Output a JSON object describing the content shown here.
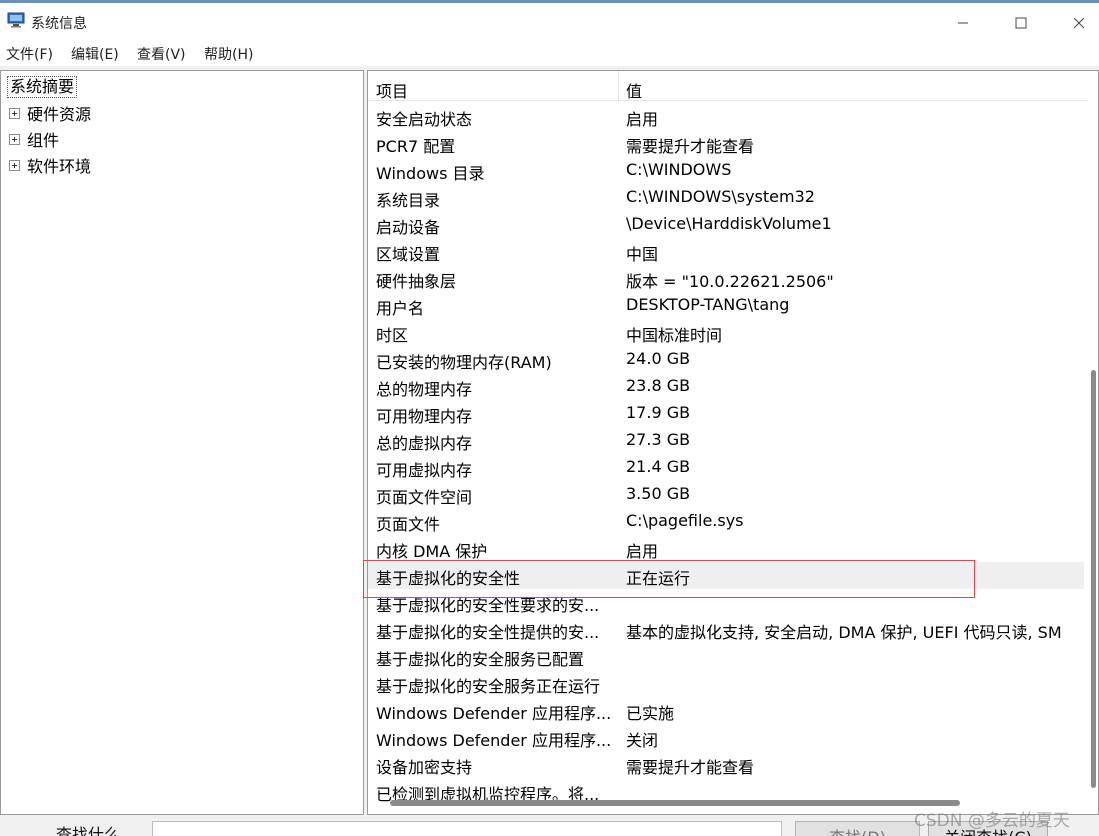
{
  "window": {
    "title": "系统信息"
  },
  "menu": {
    "file": "文件(F)",
    "edit": "编辑(E)",
    "view": "查看(V)",
    "help": "帮助(H)"
  },
  "tree": {
    "root": "系统摘要",
    "items": [
      {
        "label": "硬件资源"
      },
      {
        "label": "组件"
      },
      {
        "label": "软件环境"
      }
    ]
  },
  "list": {
    "columns": {
      "item": "项目",
      "value": "值"
    },
    "rows": [
      {
        "item": "安全启动状态",
        "value": "启用"
      },
      {
        "item": "PCR7 配置",
        "value": "需要提升才能查看"
      },
      {
        "item": "Windows 目录",
        "value": "C:\\WINDOWS"
      },
      {
        "item": "系统目录",
        "value": "C:\\WINDOWS\\system32"
      },
      {
        "item": "启动设备",
        "value": "\\Device\\HarddiskVolume1"
      },
      {
        "item": "区域设置",
        "value": "中国"
      },
      {
        "item": "硬件抽象层",
        "value": "版本 = \"10.0.22621.2506\""
      },
      {
        "item": "用户名",
        "value": "DESKTOP-TANG\\tang"
      },
      {
        "item": "时区",
        "value": "中国标准时间"
      },
      {
        "item": "已安装的物理内存(RAM)",
        "value": "24.0 GB"
      },
      {
        "item": "总的物理内存",
        "value": "23.8 GB"
      },
      {
        "item": "可用物理内存",
        "value": "17.9 GB"
      },
      {
        "item": "总的虚拟内存",
        "value": "27.3 GB"
      },
      {
        "item": "可用虚拟内存",
        "value": "21.4 GB"
      },
      {
        "item": "页面文件空间",
        "value": "3.50 GB"
      },
      {
        "item": "页面文件",
        "value": "C:\\pagefile.sys"
      },
      {
        "item": "内核 DMA 保护",
        "value": "启用"
      },
      {
        "item": "基于虚拟化的安全性",
        "value": "正在运行"
      },
      {
        "item": "基于虚拟化的安全性要求的安...",
        "value": ""
      },
      {
        "item": "基于虚拟化的安全性提供的安...",
        "value": "基本的虚拟化支持, 安全启动, DMA 保护, UEFI 代码只读, SM"
      },
      {
        "item": "基于虚拟化的安全服务已配置",
        "value": ""
      },
      {
        "item": "基于虚拟化的安全服务正在运行",
        "value": ""
      },
      {
        "item": "Windows Defender 应用程序...",
        "value": "已实施"
      },
      {
        "item": "Windows Defender 应用程序...",
        "value": "关闭"
      },
      {
        "item": "设备加密支持",
        "value": "需要提升才能查看"
      },
      {
        "item": "已检测到虚拟机监控程序。将...",
        "value": ""
      }
    ]
  },
  "find": {
    "label": "查找什么",
    "find_button": "查找(D)",
    "close_button": "关闭查找(C)"
  },
  "watermark": "CSDN @多云的夏天",
  "colors": {
    "highlight_border": "#e04848",
    "title_accent": "#6b8fb8"
  }
}
